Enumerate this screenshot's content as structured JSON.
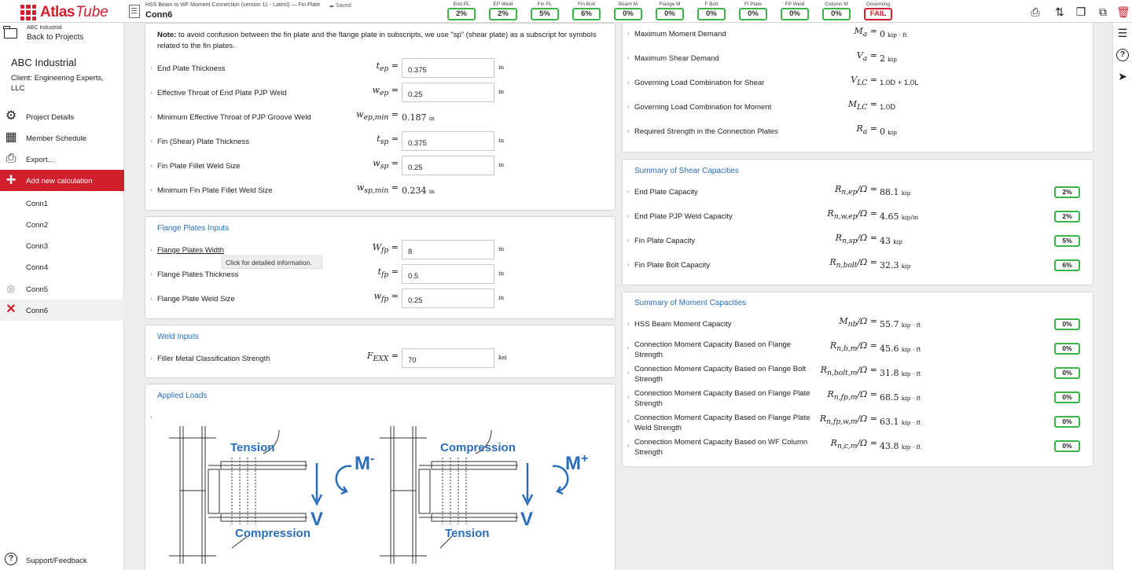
{
  "header": {
    "brand_main": "Atlas",
    "brand_sub": "Tube",
    "doc_subtitle": "HSS Beam to WF Moment Connection (version 11 - Latest) — Fin Plate",
    "saved": "Saved",
    "doc_name": "Conn6",
    "gauges": [
      {
        "label": "End PL",
        "value": "2%"
      },
      {
        "label": "EP Weld",
        "value": "2%"
      },
      {
        "label": "Fin PL",
        "value": "5%"
      },
      {
        "label": "Fin Bolt",
        "value": "6%"
      },
      {
        "label": "Beam M",
        "value": "0%"
      },
      {
        "label": "Flange M",
        "value": "0%"
      },
      {
        "label": "F Bolt",
        "value": "0%"
      },
      {
        "label": "Fl Plate",
        "value": "0%"
      },
      {
        "label": "FP Weld",
        "value": "0%"
      },
      {
        "label": "Column M",
        "value": "0%"
      },
      {
        "label": "Governing",
        "value": "FAIL"
      }
    ]
  },
  "sidebar": {
    "back_small": "ABC Industrial",
    "back_label": "Back to Projects",
    "client_name": "ABC Industrial",
    "client_sub": "Client: Engineering Experts, LLC",
    "items": [
      {
        "label": "Project Details",
        "icon": "gears-icon"
      },
      {
        "label": "Member Schedule",
        "icon": "table-icon"
      },
      {
        "label": "Export...",
        "icon": "printer-icon"
      },
      {
        "label": "Add new calculation",
        "icon": "plus-icon"
      },
      {
        "label": "Conn1"
      },
      {
        "label": "Conn2"
      },
      {
        "label": "Conn3"
      },
      {
        "label": "Conn4"
      },
      {
        "label": "Conn5",
        "icon": "target-icon"
      },
      {
        "label": "Conn6",
        "icon": "x-icon"
      }
    ],
    "support": "Support/Feedback"
  },
  "plate_inputs": {
    "note_bold": "Note:",
    "note": " to avoid confusion between the fin plate and the flange plate in subscripts, we use \"sp\" (shear plate) as a subscript for symbols related to the fin plates.",
    "rows": [
      {
        "label": "End Plate Thickness",
        "symbol": "t",
        "sub": "ep",
        "value": "0.375",
        "unit": "in"
      },
      {
        "label": "Effective Throat of End Plate PJP Weld",
        "symbol": "w",
        "sub": "ep",
        "value": "0.25",
        "unit": "in"
      },
      {
        "label": "Minimum Effective Throat of PJP Groove Weld",
        "symbol": "w",
        "sub": "ep,min",
        "value": "0.187",
        "unit": "in"
      },
      {
        "label": "Fin (Shear) Plate Thickness",
        "symbol": "t",
        "sub": "sp",
        "value": "0.375",
        "unit": "in"
      },
      {
        "label": "Fin Plate Fillet Weld Size",
        "symbol": "w",
        "sub": "sp",
        "value": "0.25",
        "unit": "in"
      },
      {
        "label": "Minimum Fin Plate Fillet Weld Size",
        "symbol": "w",
        "sub": "sp,min",
        "value": "0.234",
        "unit": "in"
      }
    ]
  },
  "flange_inputs": {
    "title": "Flange Plates Inputs",
    "tooltip": "Click for detailed information.",
    "rows": [
      {
        "label": "Flange Plates Width",
        "symbol": "W",
        "sub": "fp",
        "value": "8",
        "unit": "in"
      },
      {
        "label": "Flange Plates Thickness",
        "symbol": "t",
        "sub": "fp",
        "value": "0.5",
        "unit": "in"
      },
      {
        "label": "Flange Plate Weld Size",
        "symbol": "w",
        "sub": "fp",
        "value": "0.25",
        "unit": "in"
      }
    ]
  },
  "weld_inputs": {
    "title": "Weld Inputs",
    "rows": [
      {
        "label": "Filler Metal Classification Strength",
        "symbol": "F",
        "sub": "EXX",
        "value": "70",
        "unit": "ksi"
      }
    ]
  },
  "applied_loads": {
    "title": "Applied Loads",
    "diagram_left": {
      "top": "Tension",
      "bottom": "Compression",
      "moment": "M",
      "moment_sign": "-",
      "shear": "V"
    },
    "diagram_right": {
      "top": "Compression",
      "bottom": "Tension",
      "moment": "M",
      "moment_sign": "+",
      "shear": "V"
    }
  },
  "demands": {
    "rows": [
      {
        "label": "Maximum Moment Demand",
        "symbol": "M",
        "sub": "a",
        "value": "0",
        "unit": "kip · ft"
      },
      {
        "label": "Maximum Shear Demand",
        "symbol": "V",
        "sub": "a",
        "value": "2",
        "unit": "kip"
      },
      {
        "label": "Governing Load Combination for Shear",
        "symbol": "V",
        "sub": "LC",
        "value": "1.0D + 1.0L",
        "unit": ""
      },
      {
        "label": "Governing Load Combination for Moment",
        "symbol": "M",
        "sub": "LC",
        "value": "1.0D",
        "unit": ""
      },
      {
        "label": "Required Strength in the Connection Plates",
        "symbol": "R",
        "sub": "a",
        "value": "0",
        "unit": "kip"
      }
    ]
  },
  "shear_caps": {
    "title": "Summary of Shear Capacities",
    "rows": [
      {
        "label": "End Plate Capacity",
        "symbol": "R",
        "sub": "n,ep",
        "value": "88.1",
        "unit": "kip",
        "ratio": "2%"
      },
      {
        "label": "End Plate PJP Weld Capacity",
        "symbol": "R",
        "sub": "n,w,ep",
        "value": "4.65",
        "unit": "kip/in",
        "ratio": "2%"
      },
      {
        "label": "Fin Plate Capacity",
        "symbol": "R",
        "sub": "n,sp",
        "value": "43",
        "unit": "kip",
        "ratio": "5%"
      },
      {
        "label": "Fin Plate Bolt Capacity",
        "symbol": "R",
        "sub": "n,bolt",
        "value": "32.3",
        "unit": "kip",
        "ratio": "6%"
      }
    ]
  },
  "moment_caps": {
    "title": "Summary of Moment Capacities",
    "rows": [
      {
        "label": "HSS Beam Moment Capacity",
        "symbol": "M",
        "sub": "nb",
        "value": "55.7",
        "unit": "kip · ft",
        "ratio": "0%"
      },
      {
        "label": "Connection Moment Capacity Based on Flange Strength",
        "symbol": "R",
        "sub": "n,b,m",
        "value": "45.6",
        "unit": "kip · ft",
        "ratio": "0%"
      },
      {
        "label": "Connection Moment Capacity Based on Flange Bolt Strength",
        "symbol": "R",
        "sub": "n,bolt,m",
        "value": "31.8",
        "unit": "kip · ft",
        "ratio": "0%"
      },
      {
        "label": "Connection Moment Capacity Based on Flange Plate Strength",
        "symbol": "R",
        "sub": "n,fp,m",
        "value": "68.5",
        "unit": "kip · ft",
        "ratio": "0%"
      },
      {
        "label": "Connection Moment Capacity Based on Flange Plate Weld Strength",
        "symbol": "R",
        "sub": "n,fp,w,m",
        "value": "63.1",
        "unit": "kip · ft",
        "ratio": "0%"
      },
      {
        "label": "Connection Moment Capacity Based on WF Column Strength",
        "symbol": "R",
        "sub": "n,c,m",
        "value": "43.8",
        "unit": "kip · ft",
        "ratio": "0%"
      }
    ]
  },
  "colors": {
    "accent": "#d0202e",
    "link": "#2a6ebb",
    "ok": "#3bb54a",
    "diagram": "#2a6ebb"
  }
}
